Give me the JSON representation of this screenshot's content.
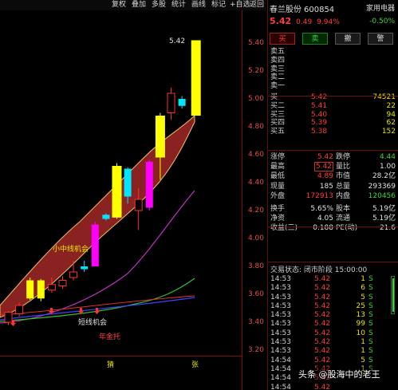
{
  "toolbar": {
    "items": [
      "复权",
      "叠加",
      "多股",
      "统计",
      "画线",
      "标记",
      "+自选",
      "返回"
    ],
    "colors": {
      "bg": "#0a0a0a",
      "text": "#d8d8d8"
    }
  },
  "chart": {
    "top_price_label": "5.42",
    "price_axis": [
      "5.40",
      "5.20",
      "5.00",
      "4.80",
      "4.60",
      "4.40",
      "4.20",
      "4.00",
      "3.80",
      "3.60",
      "3.40",
      "3.20"
    ],
    "annotations": {
      "mid_line": "小中线机会",
      "short_line": "短线机会",
      "bottom_hold": "年金托"
    },
    "bottom_labels": [
      "猜",
      "张"
    ],
    "colors": {
      "band_fill": "#8b2222",
      "band_edge": "#e8c060",
      "candle_yellow": "#ffff00",
      "candle_magenta": "#ff00ff",
      "candle_cyan": "#00e5ff",
      "ma_magenta": "#c030c0",
      "ma_green": "#30c030",
      "ma_blue": "#4040ff",
      "ma_red": "#e03030",
      "axis": "#e05050"
    },
    "candles": [
      {
        "t": 0,
        "o": 3.4,
        "c": 3.47,
        "h": 3.48,
        "l": 3.38,
        "kind": "red-hollow"
      },
      {
        "t": 1,
        "o": 3.46,
        "c": 3.52,
        "h": 3.54,
        "l": 3.44,
        "kind": "red-hollow"
      },
      {
        "t": 2,
        "o": 3.57,
        "c": 3.7,
        "h": 3.72,
        "l": 3.56,
        "kind": "yellow"
      },
      {
        "t": 3,
        "o": 3.7,
        "c": 3.57,
        "h": 3.71,
        "l": 3.55,
        "kind": "yellow"
      },
      {
        "t": 4,
        "o": 3.63,
        "c": 3.67,
        "h": 3.72,
        "l": 3.61,
        "kind": "red-hollow"
      },
      {
        "t": 5,
        "o": 3.7,
        "c": 3.66,
        "h": 3.73,
        "l": 3.64,
        "kind": "red-hollow"
      },
      {
        "t": 6,
        "o": 3.72,
        "c": 3.76,
        "h": 3.84,
        "l": 3.7,
        "kind": "red-hollow"
      },
      {
        "t": 7,
        "o": 3.78,
        "c": 3.8,
        "h": 3.84,
        "l": 3.76,
        "kind": "cyan"
      },
      {
        "t": 8,
        "o": 3.8,
        "c": 4.1,
        "h": 4.12,
        "l": 3.8,
        "kind": "magenta"
      },
      {
        "t": 9,
        "o": 4.14,
        "c": 4.17,
        "h": 4.18,
        "l": 4.13,
        "kind": "cyan"
      },
      {
        "t": 10,
        "o": 4.15,
        "c": 4.52,
        "h": 4.54,
        "l": 4.14,
        "kind": "yellow"
      },
      {
        "t": 11,
        "o": 4.3,
        "c": 4.5,
        "h": 4.51,
        "l": 4.25,
        "kind": "cyan"
      },
      {
        "t": 12,
        "o": 4.28,
        "c": 4.2,
        "h": 4.36,
        "l": 4.06,
        "kind": "red-hollow"
      },
      {
        "t": 13,
        "o": 4.22,
        "c": 4.55,
        "h": 4.56,
        "l": 4.2,
        "kind": "magenta"
      },
      {
        "t": 14,
        "o": 4.58,
        "c": 4.88,
        "h": 4.9,
        "l": 4.42,
        "kind": "yellow"
      },
      {
        "t": 15,
        "o": 4.9,
        "c": 5.04,
        "h": 5.08,
        "l": 4.85,
        "kind": "red-hollow"
      },
      {
        "t": 16,
        "o": 4.95,
        "c": 5.0,
        "h": 5.02,
        "l": 4.93,
        "kind": "cyan"
      },
      {
        "t": 17,
        "o": 4.88,
        "c": 5.42,
        "h": 5.42,
        "l": 4.88,
        "kind": "yellow"
      }
    ]
  },
  "quote": {
    "name": "春兰股份",
    "code": "600854",
    "industry": "家用电器",
    "price": "5.42",
    "change": "0.49",
    "change_pct": "9.94%",
    "industry_change": "-0.50%"
  },
  "trade_buttons": [
    "买",
    "卖",
    "撤",
    "警"
  ],
  "orderbook": {
    "asks": [
      {
        "label": "卖五",
        "price": "",
        "vol": ""
      },
      {
        "label": "卖四",
        "price": "",
        "vol": ""
      },
      {
        "label": "卖三",
        "price": "",
        "vol": ""
      },
      {
        "label": "卖二",
        "price": "",
        "vol": ""
      },
      {
        "label": "卖一",
        "price": "",
        "vol": ""
      }
    ],
    "bids": [
      {
        "label": "买一",
        "price": "5.42",
        "vol": "74521"
      },
      {
        "label": "买二",
        "price": "5.41",
        "vol": "22"
      },
      {
        "label": "买三",
        "price": "5.40",
        "vol": "94"
      },
      {
        "label": "买四",
        "price": "5.39",
        "vol": "62"
      },
      {
        "label": "买五",
        "price": "5.38",
        "vol": "152"
      }
    ]
  },
  "stats": [
    {
      "l1": "涨停",
      "v1": "5.42",
      "c1": "red",
      "l2": "跌停",
      "v2": "4.44",
      "c2": "green"
    },
    {
      "l1": "最高",
      "v1": "5.42",
      "c1": "red",
      "boxed": true,
      "l2": "量比",
      "v2": "1.00",
      "c2": "white"
    },
    {
      "l1": "最低",
      "v1": "4.89",
      "c1": "red",
      "l2": "市值",
      "v2": "28.2亿",
      "c2": "white"
    },
    {
      "l1": "现量",
      "v1": "185",
      "c1": "white",
      "l2": "总量",
      "v2": "293369",
      "c2": "white"
    },
    {
      "l1": "外盘",
      "v1": "172913",
      "c1": "red",
      "l2": "内盘",
      "v2": "120456",
      "c2": "green"
    },
    {
      "l1": "换手",
      "v1": "5.65%",
      "c1": "white",
      "l2": "股本",
      "v2": "5.19亿",
      "c2": "white"
    },
    {
      "l1": "净资",
      "v1": "4.05",
      "c1": "white",
      "l2": "流通",
      "v2": "5.19亿",
      "c2": "white"
    },
    {
      "l1": "收益(三)",
      "v1": "0.188",
      "c1": "white",
      "l2": "PE(动)",
      "v2": "21.6",
      "c2": "white"
    }
  ],
  "trades_status": "交易状态: 闭市阶段 15:00:00",
  "trades": [
    {
      "time": "14:53",
      "price": "5.42",
      "vol": "1",
      "flag": "S",
      "fc": "green"
    },
    {
      "time": "14:53",
      "price": "5.42",
      "vol": "6",
      "flag": "S",
      "fc": "green"
    },
    {
      "time": "14:53",
      "price": "5.42",
      "vol": "5",
      "flag": "S",
      "fc": "green"
    },
    {
      "time": "14:53",
      "price": "5.42",
      "vol": "25",
      "flag": "S",
      "fc": "green"
    },
    {
      "time": "14:53",
      "price": "5.42",
      "vol": "13",
      "flag": "S",
      "fc": "green"
    },
    {
      "time": "14:53",
      "price": "5.42",
      "vol": "99",
      "flag": "S",
      "fc": "green"
    },
    {
      "time": "14:53",
      "price": "5.42",
      "vol": "10",
      "flag": "S",
      "fc": "green"
    },
    {
      "time": "14:53",
      "price": "5.42",
      "vol": "1",
      "flag": "S",
      "fc": "green"
    },
    {
      "time": "14:53",
      "price": "5.42",
      "vol": "1",
      "flag": "S",
      "fc": "green"
    },
    {
      "time": "14:54",
      "price": "5.42",
      "vol": "5",
      "flag": "S",
      "fc": "green"
    },
    {
      "time": "14:54",
      "price": "5.42",
      "vol": "1",
      "flag": "S",
      "fc": "green"
    },
    {
      "time": "14:54",
      "price": "5.42",
      "vol": "",
      "flag": "",
      "fc": "green"
    },
    {
      "time": "14:54",
      "price": "5.42",
      "vol": "",
      "flag": "",
      "fc": "green"
    }
  ],
  "watermark": "头条 @股海中的老王"
}
